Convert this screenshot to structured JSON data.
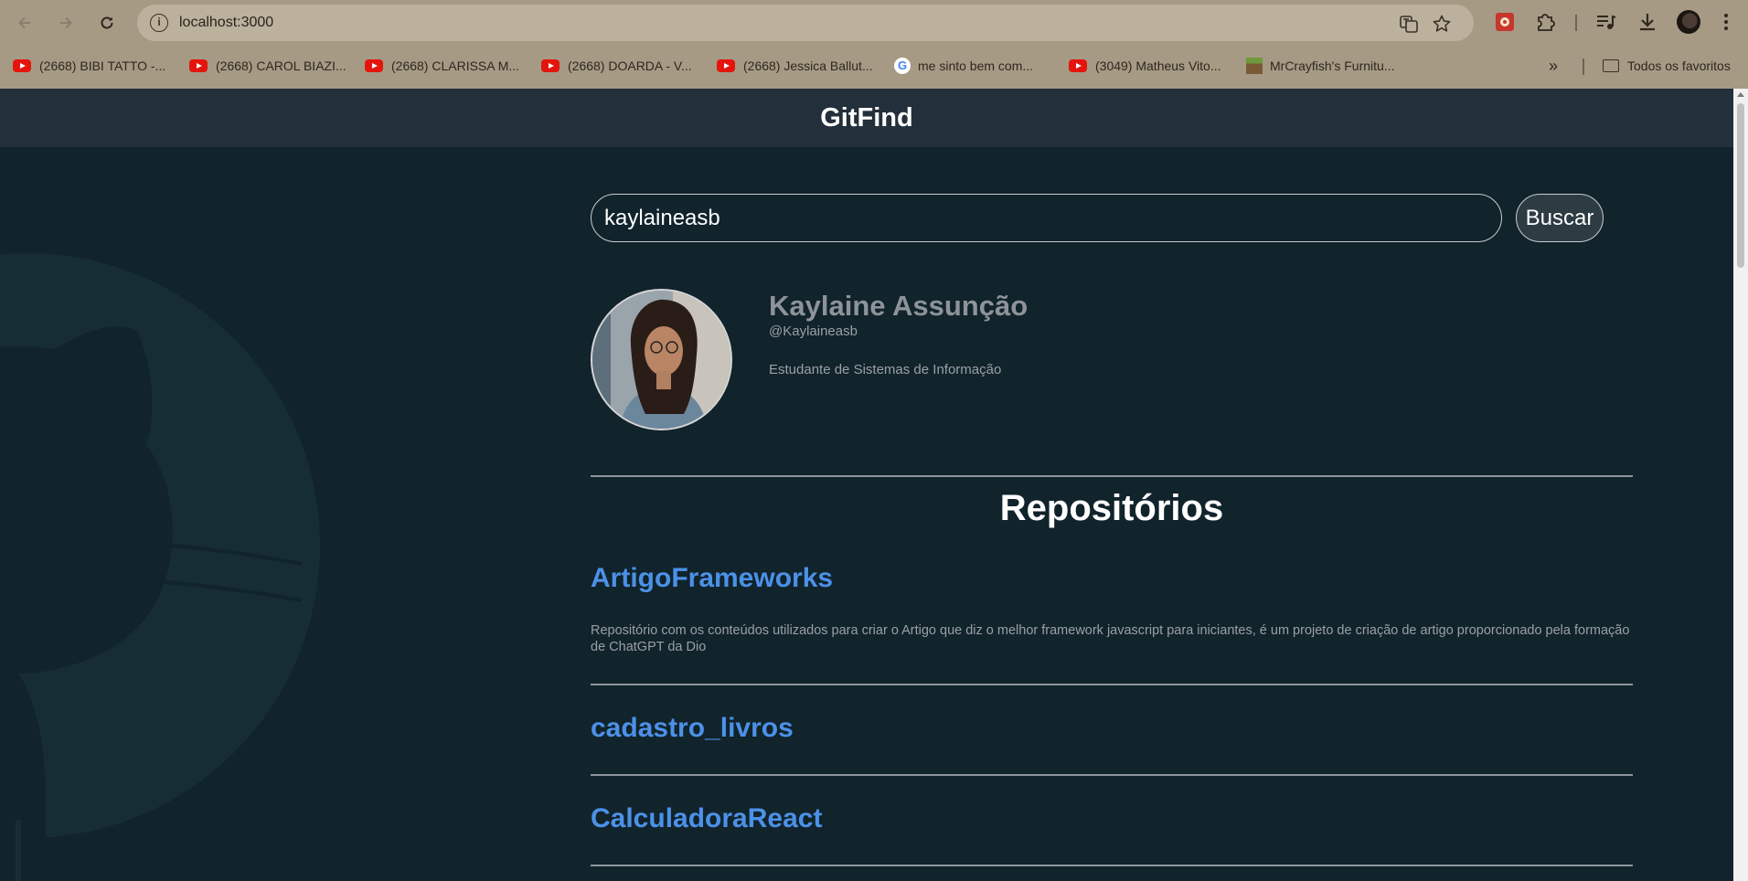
{
  "browser": {
    "url": "localhost:3000",
    "bookmarks": [
      {
        "label": "(2668) BIBI TATTO -...",
        "icon": "youtube-icon"
      },
      {
        "label": "(2668) CAROL BIAZI...",
        "icon": "youtube-icon"
      },
      {
        "label": "(2668) CLARISSA M...",
        "icon": "youtube-icon"
      },
      {
        "label": "(2668) DOARDA - V...",
        "icon": "youtube-icon"
      },
      {
        "label": "(2668) Jessica Ballut...",
        "icon": "youtube-icon"
      },
      {
        "label": "me sinto bem com...",
        "icon": "google-icon"
      },
      {
        "label": "(3049) Matheus Vito...",
        "icon": "youtube-icon"
      },
      {
        "label": "MrCrayfish's Furnitu...",
        "icon": "minecraft-icon"
      }
    ],
    "all_bookmarks_label": "Todos os favoritos"
  },
  "app": {
    "title": "GitFind"
  },
  "search": {
    "value": "kaylaineasb",
    "button_label": "Buscar"
  },
  "profile": {
    "name": "Kaylaine Assunção",
    "login": "@Kaylaineasb",
    "bio": "Estudante de Sistemas de Informação"
  },
  "repositories": {
    "title": "Repositórios",
    "items": [
      {
        "name": "ArtigoFrameworks",
        "description": "Repositório com os conteúdos utilizados para criar o Artigo que diz o melhor framework javascript para iniciantes, é um projeto de criação de artigo proporcionado pela formação de ChatGPT da Dio"
      },
      {
        "name": "cadastro_livros",
        "description": ""
      },
      {
        "name": "CalculadoraReact",
        "description": ""
      }
    ]
  },
  "colors": {
    "page_background": "#11232b",
    "header_background": "#232f3a",
    "repo_link": "#4c91e8",
    "browser_chrome": "#a69a84"
  }
}
